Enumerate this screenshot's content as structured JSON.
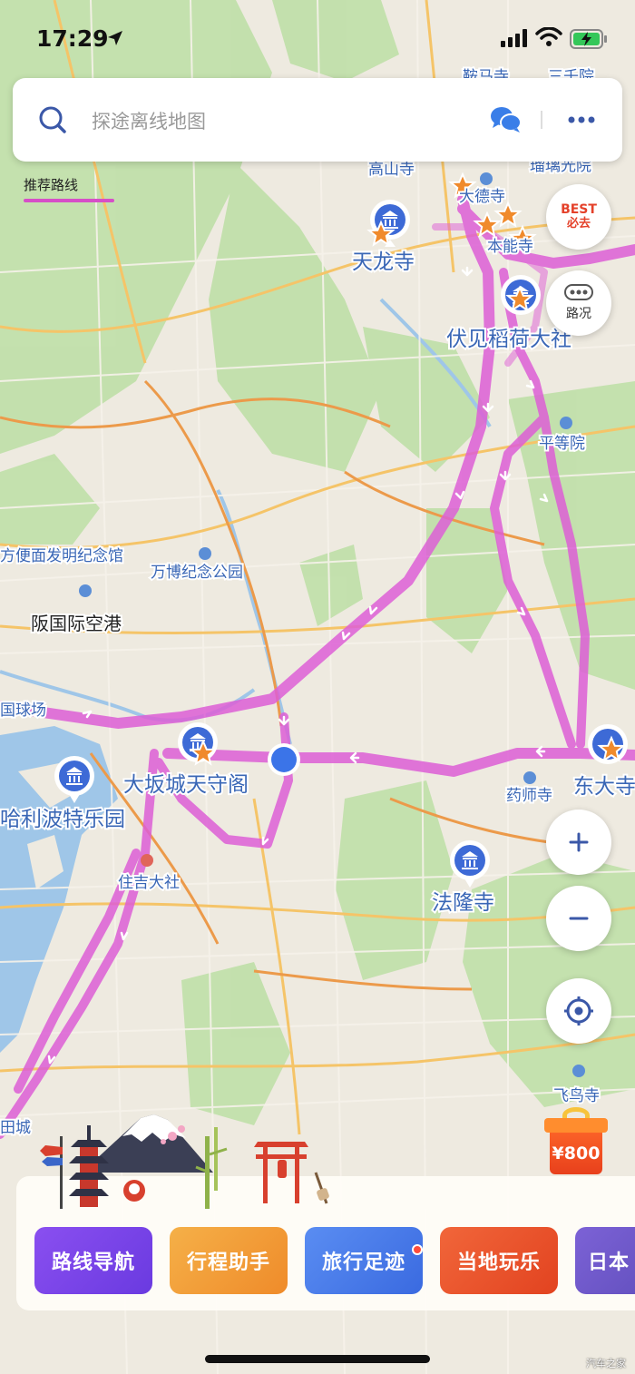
{
  "status_bar": {
    "time": "17:29"
  },
  "search": {
    "placeholder": "探途离线地图"
  },
  "recommend_tab": "推荐路线",
  "best_button": {
    "line1": "BEST",
    "line2": "必去"
  },
  "traffic_button": {
    "label": "路况"
  },
  "zoom": {
    "in": "+",
    "out": "−"
  },
  "gift": {
    "amount": "¥800"
  },
  "tiles": [
    {
      "label": "路线导航",
      "color": "#7445e8"
    },
    {
      "label": "行程助手",
      "color": "#f29b36"
    },
    {
      "label": "旅行足迹",
      "color": "#4a7ce9"
    },
    {
      "label": "当地玩乐",
      "color": "#ea5428"
    },
    {
      "label": "日本",
      "color": "#6b55c7"
    }
  ],
  "watermark": "汽车之家",
  "map": {
    "route_color": "#dd5fd6",
    "labels": {
      "kurama": "鞍马寺",
      "sanzenin": "三千院",
      "jakkoin": "瑠璃光院",
      "takayama": "高山寺",
      "daitokuji": "大德寺",
      "honnoji": "本能寺",
      "tenryuji": "天龙寺",
      "fushimi": "伏见稻荷大社",
      "byodoin": "平等院",
      "momofuku": "方便面发明纪念馆",
      "expo": "万博纪念公园",
      "itami": "阪国际空港",
      "stadium": "国球场",
      "osaka_castle": "大坂城天守阁",
      "usj": "哈利波特乐园",
      "sumiyoshi": "住吉大社",
      "yakushiji": "药师寺",
      "todaiji": "东大寺",
      "horyuji": "法隆寺",
      "asukadera": "飞鸟寺",
      "castle_bl": "田城"
    }
  }
}
